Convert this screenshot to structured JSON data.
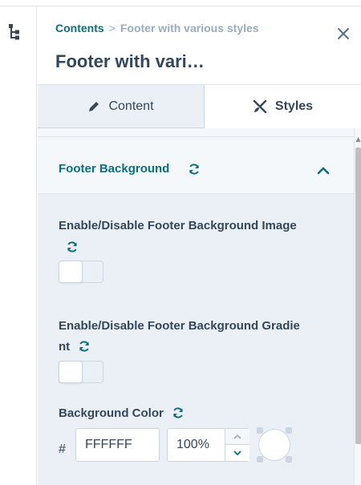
{
  "breadcrumb": {
    "parent": "Contents",
    "separator": ">",
    "current": "Footer with various styles"
  },
  "title": "Footer with vari…",
  "tabs": [
    {
      "label": "Content",
      "icon": "pencil-icon",
      "active": false
    },
    {
      "label": "Styles",
      "icon": "brush-ruler-icon",
      "active": true
    }
  ],
  "section": {
    "title": "Footer Background",
    "expanded": true
  },
  "fields": {
    "bg_image_toggle": {
      "label_line1": "Enable/Disable Footer Background Image",
      "value": false
    },
    "bg_gradient_toggle": {
      "label_line1": "Enable/Disable Footer Background Gradie",
      "label_line2": "nt",
      "value": false
    },
    "bg_color": {
      "label": "Background Color",
      "prefix": "#",
      "hex": "FFFFFF",
      "opacity": "100%"
    }
  },
  "colors": {
    "accent": "#0b6f7d",
    "text": "#33475b",
    "muted": "#99acc2",
    "panel": "#eaf0f6",
    "border": "#cbd6e2"
  }
}
